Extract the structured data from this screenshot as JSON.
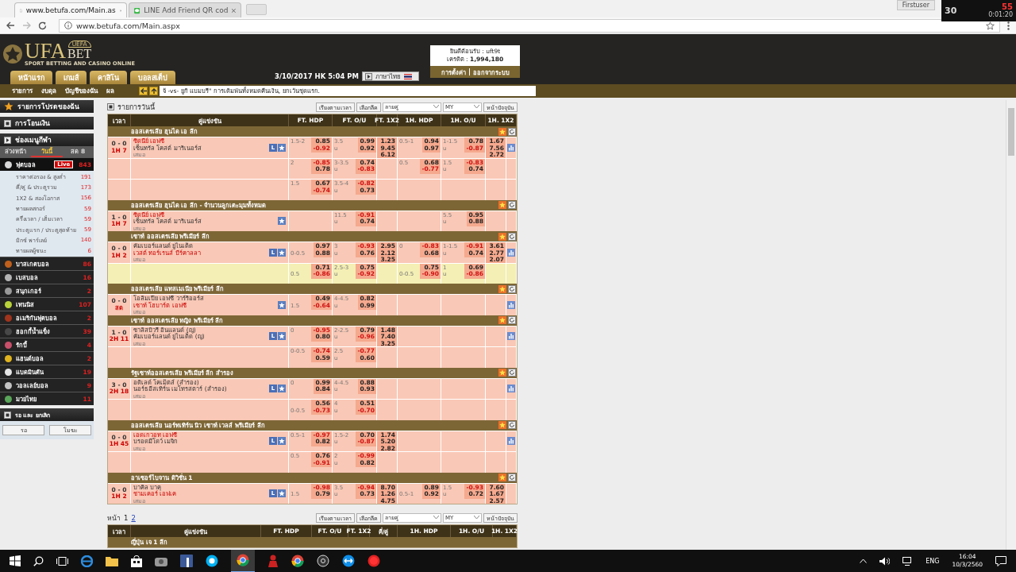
{
  "browser": {
    "tabs": [
      {
        "title": "www.betufa.com/Main.as",
        "selected": true
      },
      {
        "title": "LINE Add Friend QR cod",
        "selected": false
      }
    ],
    "profile": "Firstuser",
    "address": "www.betufa.com/Main.aspx"
  },
  "recorder_widget": {
    "counter": "55",
    "frame_rate": "30",
    "elapsed": "0:01:20"
  },
  "header": {
    "logo": {
      "badge": "UEFA",
      "name_1": "UFA",
      "name_2": "BET",
      "tagline": "SPORT BETTING AND CASINO ONLINE"
    },
    "nav_tabs": [
      "หน้าแรก",
      "เกมส์",
      "คาสิโน",
      "บอลสเต็ป"
    ],
    "datetime": "3/10/2017 HK 5:04 PM",
    "language": "ภาษาไทย",
    "account": {
      "welcome": "ยินดีต้อนรับ : uft9t",
      "credit": "เครดิต : **1,994,180**",
      "links": [
        "การตั้งค่า",
        "ออกจากระบบ"
      ]
    },
    "subnav": [
      "รายการ",
      "งบดุล",
      "บัญชีของฉัน",
      "ผล"
    ],
    "ticker": "จ้ -vs- ยูกิ แบมบรี\" การเดิมพันทั้งหมดคืนเงิน, ยกเว้นชุดแรก."
  },
  "sidebar": {
    "favorites": "รายการโปรดของฉัน",
    "transfer": "การโอนเงิน",
    "sports_menu": "ช่องเมนูกีฬา",
    "tabs": [
      {
        "label": "ล่วงหน้า",
        "selected": false
      },
      {
        "label": "วันนี้",
        "selected": true
      },
      {
        "label": "สด 8",
        "selected": false
      }
    ],
    "sports": [
      {
        "name": "ฟุตบอล",
        "count": "843",
        "live": "Live",
        "color": "#d8d8d8",
        "expanded": true,
        "children": [
          {
            "name": "ราคาต่อรอง & สูงต่ำ",
            "count": "191"
          },
          {
            "name": "คี่/คู่ & ประตูรวม",
            "count": "173"
          },
          {
            "name": "1X2 & สองโอกาส",
            "count": "156"
          },
          {
            "name": "ทายผลสกอร์",
            "count": "59"
          },
          {
            "name": "ครึ่งเวลา / เต็มเวลา",
            "count": "59"
          },
          {
            "name": "ประตูแรก / ประตูสุดท้าย",
            "count": "59"
          },
          {
            "name": "มิกซ์ พาร์เลย์",
            "count": "140"
          },
          {
            "name": "ทายผลผู้ชนะ",
            "count": "6"
          }
        ]
      },
      {
        "name": "บาสเกตบอล",
        "count": "86",
        "color": "#c0601c",
        "expanded": false
      },
      {
        "name": "เบสบอล",
        "count": "16",
        "color": "#b4b4b4",
        "expanded": false
      },
      {
        "name": "สนุกเกอร์",
        "count": "2",
        "color": "#9a9a9a",
        "expanded": false
      },
      {
        "name": "เทนนิส",
        "count": "107",
        "color": "#b8d23a",
        "expanded": false
      },
      {
        "name": "อเมริกันฟุตบอล",
        "count": "2",
        "color": "#a0341c",
        "expanded": false
      },
      {
        "name": "ฮอกกี้น้ำแข็ง",
        "count": "39",
        "color": "#484848",
        "expanded": false
      },
      {
        "name": "รักบี้",
        "count": "4",
        "color": "#c8506a",
        "expanded": false
      },
      {
        "name": "แฮนด์บอล",
        "count": "2",
        "color": "#e0b41e",
        "expanded": false
      },
      {
        "name": "แบดมินตัน",
        "count": "19",
        "color": "#e6e6e6",
        "expanded": false
      },
      {
        "name": "วอลเลย์บอล",
        "count": "9",
        "color": "#c4c4c4",
        "expanded": false
      },
      {
        "name": "มวยไทย",
        "count": "11",
        "color": "#5aa65a",
        "expanded": false
      }
    ],
    "waiting": {
      "title": "รอ และ ยกเลิก",
      "buttons": [
        "รอ",
        "โมฆะ"
      ]
    }
  },
  "main": {
    "title": "รายการวันนี้",
    "toolbar": {
      "sort": "เรียงตามเวลา",
      "league": "เลือกลีค",
      "odds_type": "ลายคู่",
      "currency": "MY",
      "refresh": "หน้าปัจจุบัน"
    },
    "columns": [
      "เวลา",
      "คู่แข่งขัน",
      "FT. HDP",
      "FT. O/U",
      "FT. 1X2",
      "1H. HDP",
      "1H. O/U",
      "1H. 1X2"
    ],
    "leagues": [
      {
        "name": "ออสเตรเลีย ฮุนได เอ ลีก",
        "matches": [
          {
            "score": "0 - 0",
            "time": "1H 7",
            "home": {
              "name": "ซิดนีย์ เอฟซี",
              "favorite": true
            },
            "away": {
              "name": "เซ็นทรัล โคสต์ มาริเนอร์ส",
              "favorite": false
            },
            "draw": "เสมอ",
            "live_button": "L",
            "stats": true,
            "lines": [
              {
                "highlighted": false,
                "ft_hdp": {
                  "line": "1.5-2",
                  "away_favored": false,
                  "home": "0.85",
                  "away": "-0.92"
                },
                "ft_ou": {
                  "line": "3.5",
                  "under": "u",
                  "over_odds": "0.99",
                  "under_odds": "0.92"
                },
                "ft_1x2": [
                  "1.23",
                  "9.45",
                  "6.12"
                ],
                "h1_hdp": {
                  "line": "0.5-1",
                  "away_favored": false,
                  "home": "0.94",
                  "away": "0.97"
                },
                "h1_ou": {
                  "line": "1-1.5",
                  "under": "u",
                  "over_odds": "0.78",
                  "under_odds": "-0.87"
                },
                "h1_1x2": [
                  "1.67",
                  "7.56",
                  "2.72"
                ]
              },
              {
                "highlighted": false,
                "ft_hdp": {
                  "line": "2",
                  "away_favored": false,
                  "home": "-0.85",
                  "away": "0.78"
                },
                "ft_ou": {
                  "line": "3-3.5",
                  "under": "u",
                  "over_odds": "0.74",
                  "under_odds": "-0.83"
                },
                "h1_hdp": {
                  "line": "0.5",
                  "away_favored": false,
                  "home": "0.68",
                  "away": "-0.77"
                },
                "h1_ou": {
                  "line": "1.5",
                  "under": "u",
                  "over_odds": "-0.83",
                  "under_odds": "0.74"
                }
              },
              {
                "highlighted": false,
                "ft_hdp": {
                  "line": "1.5",
                  "away_favored": false,
                  "home": "0.67",
                  "away": "-0.74"
                },
                "ft_ou": {
                  "line": "3.5-4",
                  "under": "u",
                  "over_odds": "-0.82",
                  "under_odds": "0.73"
                }
              }
            ]
          }
        ]
      },
      {
        "name": "ออสเตรเลีย ฮุนได เอ ลีก - จำนวนลูกเตะมุมทั้งหมด",
        "matches": [
          {
            "score": "1 - 0",
            "time": "1H 7",
            "home": {
              "name": "ซิดนีย์ เอฟซี",
              "favorite": true
            },
            "away": {
              "name": "เซ็นทรัล โคสต์ มาริเนอร์ส",
              "favorite": false
            },
            "draw": "เสมอ",
            "stats": false,
            "lines": [
              {
                "highlighted": false,
                "ft_ou": {
                  "line": "11.5",
                  "under": "u",
                  "over_odds": "-0.91",
                  "under_odds": "0.74"
                },
                "h1_ou": {
                  "line": "5.5",
                  "under": "u",
                  "over_odds": "0.95",
                  "under_odds": "0.88"
                }
              }
            ]
          }
        ]
      },
      {
        "name": "เซาท์ ออสเตรเลีย พรีเมียร์ ลีก",
        "matches": [
          {
            "score": "0 - 0",
            "time": "1H 2",
            "home": {
              "name": "คัมเบอร์แลนด์ ยูไนเต็ด",
              "favorite": false
            },
            "away": {
              "name": "เวสต์ ทอร์เรนส์ บีร์คาลลา",
              "favorite": true
            },
            "draw": "เสมอ",
            "live_button": "L",
            "stats": true,
            "lines": [
              {
                "highlighted": false,
                "ft_hdp": {
                  "line": "0-0.5",
                  "away_favored": true,
                  "home": "0.97",
                  "away": "0.88"
                },
                "ft_ou": {
                  "line": "3",
                  "under": "u",
                  "over_odds": "-0.93",
                  "under_odds": "0.76"
                },
                "ft_1x2": [
                  "2.95",
                  "2.12",
                  "3.25"
                ],
                "h1_hdp": {
                  "line": "0",
                  "away_favored": false,
                  "home": "-0.83",
                  "away": "0.68"
                },
                "h1_ou": {
                  "line": "1-1.5",
                  "under": "u",
                  "over_odds": "-0.91",
                  "under_odds": "0.74"
                },
                "h1_1x2": [
                  "3.61",
                  "2.77",
                  "2.07"
                ]
              },
              {
                "highlighted": true,
                "ft_hdp": {
                  "line": "0.5",
                  "away_favored": true,
                  "home": "0.71",
                  "away": "-0.86"
                },
                "ft_ou": {
                  "line": "2.5-3",
                  "under": "u",
                  "over_odds": "0.75",
                  "under_odds": "-0.92"
                },
                "h1_hdp": {
                  "line": "0-0.5",
                  "away_favored": true,
                  "home": "0.75",
                  "away": "-0.90"
                },
                "h1_ou": {
                  "line": "1",
                  "under": "u",
                  "over_odds": "0.69",
                  "under_odds": "-0.86"
                }
              }
            ]
          }
        ]
      },
      {
        "name": "ออสเตรเลีย แทสเมเนีย พรีเมียร์ ลีก",
        "matches": [
          {
            "score": "0 - 0",
            "time": "สด",
            "home": {
              "name": "โอลิมเปีย เอฟซี วาร์ริออร์ส",
              "favorite": false
            },
            "away": {
              "name": "เซาท์ โฮบาร์ต เอฟซี",
              "favorite": true
            },
            "draw": "เสมอ",
            "stats": true,
            "lines": [
              {
                "highlighted": false,
                "ft_hdp": {
                  "line": "1.5",
                  "away_favored": true,
                  "home": "0.49",
                  "away": "-0.64"
                },
                "ft_ou": {
                  "line": "4-4.5",
                  "under": "u",
                  "over_odds": "0.82",
                  "under_odds": "0.99"
                }
              }
            ]
          }
        ]
      },
      {
        "name": "เซาท์ ออสเตรเลีย หญิง พรีเมียร์ ลีก",
        "matches": [
          {
            "score": "1 - 0",
            "time": "2H 11",
            "home": {
              "name": "ซาลิสบิวรี่ อินแลนด์ (ญ)",
              "favorite": false
            },
            "away": {
              "name": "คัมเบอร์แลนด์ ยูไนเต็ด (ญ)",
              "favorite": false
            },
            "draw": "เสมอ",
            "live_button": "L",
            "stats": true,
            "lines": [
              {
                "highlighted": false,
                "ft_hdp": {
                  "line": "0",
                  "away_favored": false,
                  "home": "-0.95",
                  "away": "0.80"
                },
                "ft_ou": {
                  "line": "2-2.5",
                  "under": "u",
                  "over_odds": "0.79",
                  "under_odds": "-0.96"
                },
                "ft_1x2": [
                  "1.48",
                  "7.40",
                  "3.25"
                ]
              },
              {
                "highlighted": false,
                "ft_hdp": {
                  "line": "0-0.5",
                  "away_favored": false,
                  "home": "-0.74",
                  "away": "0.59"
                },
                "ft_ou": {
                  "line": "2.5",
                  "under": "u",
                  "over_odds": "-0.77",
                  "under_odds": "0.60"
                }
              }
            ]
          }
        ]
      },
      {
        "name": "รัฐเซาท์ออสเตรเลีย พรีเมียร์ ลีก สำรอง",
        "matches": [
          {
            "score": "3 - 0",
            "time": "2H 18",
            "home": {
              "name": "อดิเลด์ โคเม็ตส์ (สำรอง)",
              "favorite": false
            },
            "away": {
              "name": "นอร์ธอีสเทิร์น เมโทรสตาร์ (สำรอง)",
              "favorite": false
            },
            "draw": "เสมอ",
            "live_button": "L",
            "stats": true,
            "lines": [
              {
                "highlighted": false,
                "ft_hdp": {
                  "line": "0",
                  "away_favored": false,
                  "home": "0.99",
                  "away": "0.84"
                },
                "ft_ou": {
                  "line": "4-4.5",
                  "under": "u",
                  "over_odds": "0.88",
                  "under_odds": "0.93"
                }
              },
              {
                "highlighted": false,
                "ft_hdp": {
                  "line": "0-0.5",
                  "away_favored": true,
                  "home": "0.56",
                  "away": "-0.73"
                },
                "ft_ou": {
                  "line": "4",
                  "under": "u",
                  "over_odds": "0.51",
                  "under_odds": "-0.70"
                }
              }
            ]
          }
        ]
      },
      {
        "name": "ออสเตรเลีย นอร์ทเทิร์น นิว เซาท์ เวลส์ พรีเมียร์ ลีก",
        "matches": [
          {
            "score": "0 - 0",
            "time": "1H 45",
            "home": {
              "name": "เอดเกวอท เอฟซี",
              "favorite": true
            },
            "away": {
              "name": "บรอดมีโดว์ เมจิก",
              "favorite": false
            },
            "draw": "เสมอ",
            "live_button": "L",
            "stats": true,
            "lines": [
              {
                "highlighted": false,
                "ft_hdp": {
                  "line": "0.5-1",
                  "away_favored": false,
                  "home": "-0.97",
                  "away": "0.82"
                },
                "ft_ou": {
                  "line": "1.5-2",
                  "under": "u",
                  "over_odds": "0.70",
                  "under_odds": "-0.87"
                },
                "ft_1x2": [
                  "1.74",
                  "5.20",
                  "2.82"
                ]
              },
              {
                "highlighted": false,
                "ft_hdp": {
                  "line": "0.5",
                  "away_favored": false,
                  "home": "0.76",
                  "away": "-0.91"
                },
                "ft_ou": {
                  "line": "2",
                  "under": "u",
                  "over_odds": "-0.99",
                  "under_odds": "0.82"
                }
              }
            ]
          }
        ]
      },
      {
        "name": "อาเซอร์ไบจาน ดิวิชั่น 1",
        "matches": [
          {
            "score": "0 - 0",
            "time": "1H 2",
            "home": {
              "name": "บาคิล บาคุ",
              "favorite": false
            },
            "away": {
              "name": "ชามเคอร์ เอฟเค",
              "favorite": true
            },
            "draw": "เสมอ",
            "live_button": "L",
            "stats": false,
            "lines": [
              {
                "highlighted": false,
                "ft_hdp": {
                  "line": "1.5",
                  "away_favored": true,
                  "home": "-0.98",
                  "away": "0.79"
                },
                "ft_ou": {
                  "line": "3.5",
                  "under": "u",
                  "over_odds": "-0.94",
                  "under_odds": "0.73"
                },
                "ft_1x2": [
                  "8.70",
                  "1.26",
                  "4.75"
                ],
                "h1_hdp": {
                  "line": "0.5-1",
                  "away_favored": true,
                  "home": "0.89",
                  "away": "0.92"
                },
                "h1_ou": {
                  "line": "1.5",
                  "under": "u",
                  "over_odds": "-0.93",
                  "under_odds": "0.72"
                },
                "h1_1x2": [
                  "7.60",
                  "1.67",
                  "2.57"
                ]
              }
            ]
          }
        ]
      }
    ],
    "pager": {
      "label": "หน้า",
      "pages": [
        {
          "label": "1",
          "selected": true
        },
        {
          "label": "2",
          "selected": false
        }
      ]
    },
    "toolbar_2": {
      "sort": "เรียงตามเวลา",
      "league": "เลือกลีค",
      "odds_type": "ลายคู่",
      "currency": "MY",
      "refresh": "หน้าปัจจุบัน"
    },
    "columns_2": [
      "เวลา",
      "คู่แข่งขัน",
      "FT. HDP",
      "FT. O/U",
      "FT. 1X2",
      "คี่/คู่",
      "1H. HDP",
      "1H. O/U",
      "1H. 1X2"
    ],
    "next_league": "ญี่ปุ่น เจ 1 ลีก"
  },
  "taskbar": {
    "language": "ENG",
    "time": "16:04",
    "date": "10/3/2560"
  }
}
